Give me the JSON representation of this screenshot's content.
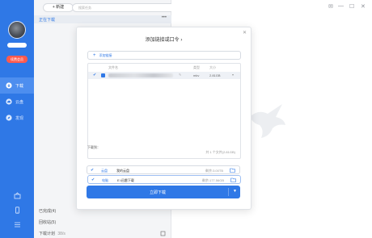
{
  "rail": {
    "vip_badge": "续费会员",
    "nav": [
      {
        "label": "下载",
        "icon": "download-icon"
      },
      {
        "label": "云盘",
        "icon": "cloud-icon"
      },
      {
        "label": "发现",
        "icon": "discover-icon"
      }
    ],
    "bottom_icons": [
      "mailbox-icon",
      "phone-icon",
      "menu-icon"
    ]
  },
  "toolbar": {
    "new_label": "+ 新建",
    "search_placeholder": "搜索任务"
  },
  "list": {
    "downloading_header": "正在下载",
    "completed": "已完成(4)",
    "trash": "回收站(5)",
    "speed_label": "下载计划",
    "speed_value": "38/s"
  },
  "dialog": {
    "title": "添加链接或口令 ›",
    "add_link_label": "添加链接",
    "columns": {
      "name": "文件名",
      "type": "类型",
      "size": "大小"
    },
    "file": {
      "type": "mkv",
      "size": "2.81GB"
    },
    "summary": "共 1 个文件(2.81GB)",
    "save_to_label": "下载到：",
    "targets": [
      {
        "kind": "电脑",
        "path": "E:\\迅雷下载",
        "space": "剩余:177.56GB"
      },
      {
        "kind": "云盘",
        "path": "我的云盘",
        "space": "剩余:3.00TB"
      }
    ],
    "download_button": "立即下载"
  },
  "colors": {
    "accent": "#2f78e6",
    "vip": "#ff5a4e"
  }
}
